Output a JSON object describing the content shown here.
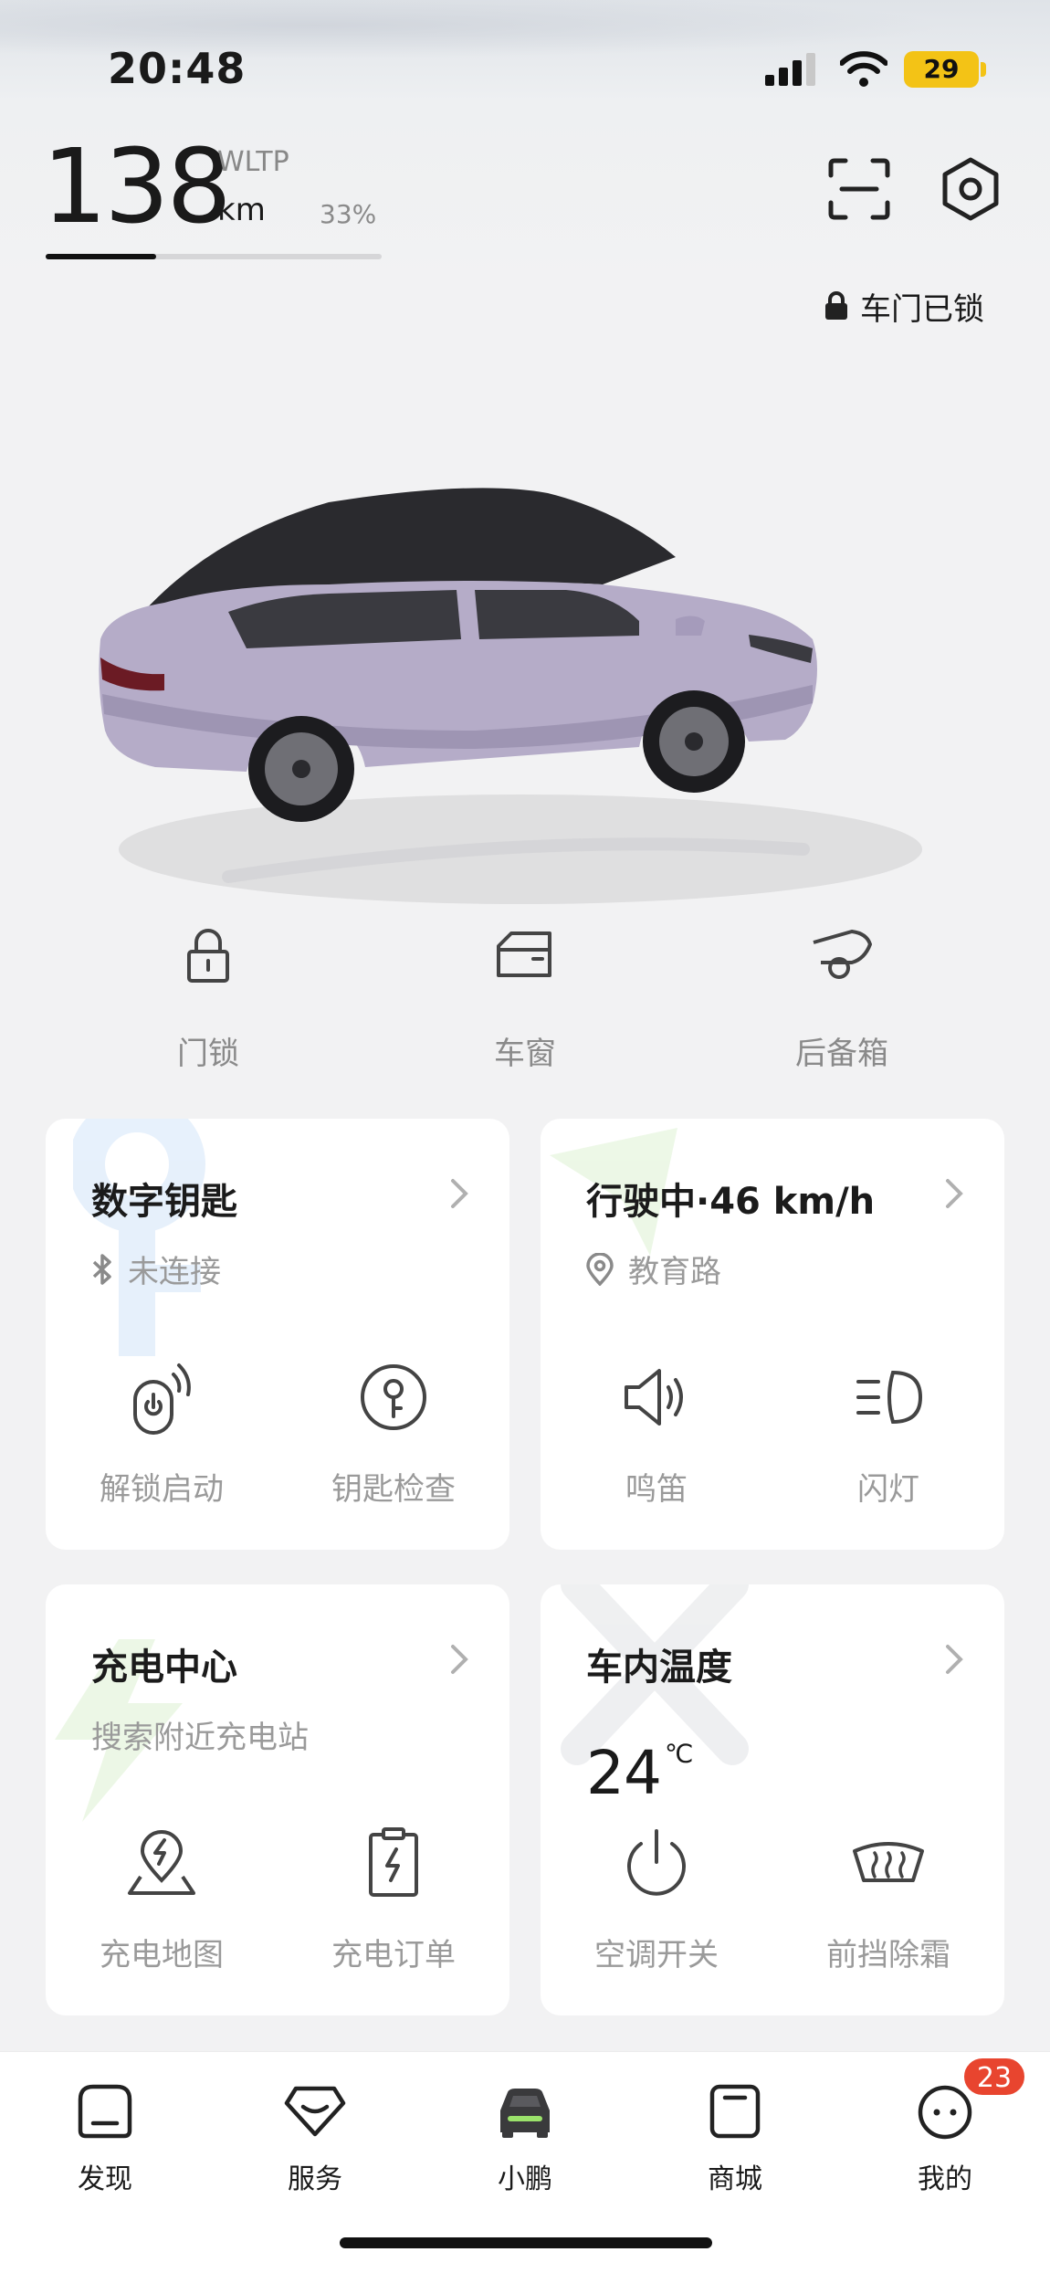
{
  "status_bar": {
    "time": "20:48",
    "battery": "29"
  },
  "range": {
    "value": "138",
    "standard": "WLTP",
    "unit": "km",
    "percent_label": "33%",
    "percent_fraction": 0.33
  },
  "door_status": "车门已锁",
  "quick_controls": [
    {
      "label": "门锁",
      "icon": "padlock-icon"
    },
    {
      "label": "车窗",
      "icon": "window-icon"
    },
    {
      "label": "后备箱",
      "icon": "trunk-icon"
    }
  ],
  "cards": {
    "digital_key": {
      "title": "数字钥匙",
      "subtitle": "未连接",
      "subtitle_icon": "bluetooth-icon",
      "actions": [
        {
          "label": "解锁启动",
          "icon": "remote-start-icon"
        },
        {
          "label": "钥匙检查",
          "icon": "key-check-icon"
        }
      ]
    },
    "driving": {
      "title": "行驶中·46 km/h",
      "subtitle": "教育路",
      "subtitle_icon": "location-pin-icon",
      "actions": [
        {
          "label": "鸣笛",
          "icon": "horn-icon"
        },
        {
          "label": "闪灯",
          "icon": "headlight-icon"
        }
      ]
    },
    "charging": {
      "title": "充电中心",
      "subtitle": "搜索附近充电站",
      "actions": [
        {
          "label": "充电地图",
          "icon": "charge-map-icon"
        },
        {
          "label": "充电订单",
          "icon": "charge-order-icon"
        }
      ]
    },
    "cabin_temp": {
      "title": "车内温度",
      "value": "24",
      "unit": "℃",
      "actions": [
        {
          "label": "空调开关",
          "icon": "power-icon"
        },
        {
          "label": "前挡除霜",
          "icon": "defrost-icon"
        }
      ]
    }
  },
  "bottom_nav": [
    {
      "label": "发现",
      "icon": "discover-icon"
    },
    {
      "label": "服务",
      "icon": "service-icon"
    },
    {
      "label": "小鹏",
      "icon": "car-icon",
      "active": true
    },
    {
      "label": "商城",
      "icon": "store-icon"
    },
    {
      "label": "我的",
      "icon": "profile-icon"
    }
  ],
  "notification_badge": "23",
  "colors": {
    "accent_green": "#9be26b",
    "badge_red": "#e8452f",
    "battery_yellow": "#f3c316",
    "car_body": "#b5acc8"
  }
}
